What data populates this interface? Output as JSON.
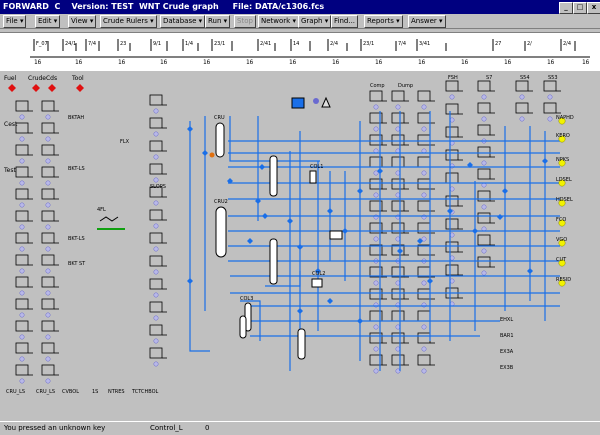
{
  "window": {
    "title": "FORWARD  C    Version: TEST  WNT Crude graph     File: DATA/c1306.fcs",
    "minimize": "_",
    "maximize": "□",
    "close": "x"
  },
  "menubar": {
    "items": [
      {
        "label": "File ▾",
        "dim": false
      },
      {
        "label": "Edit ▾",
        "dim": false
      },
      {
        "label": "View ▾",
        "dim": false
      },
      {
        "label": "Crude Rulers ▾",
        "dim": false
      },
      {
        "label": "Database ▾",
        "dim": false
      },
      {
        "label": "Run ▾",
        "dim": false
      },
      {
        "label": "Stop",
        "dim": true
      },
      {
        "label": "Network ▾",
        "dim": false
      },
      {
        "label": "Graph ▾",
        "dim": false
      },
      {
        "label": "Find...",
        "dim": false
      },
      {
        "label": "Reports ▾",
        "dim": false
      },
      {
        "label": "Answer ▾",
        "dim": false
      }
    ]
  },
  "timeline": {
    "start": "16",
    "labels": [
      "16",
      "16",
      "16",
      "16",
      "16",
      "16",
      "16",
      "16",
      "16",
      "16",
      "16",
      "16",
      "16"
    ]
  },
  "flowsheet": {
    "feed_labels": [
      "Fuel",
      "CrudeCds",
      "Tool"
    ],
    "left_labels": [
      "Cest",
      "Test"
    ],
    "misc_labels": [
      "BKTAH",
      "BKT-LS",
      "BKT-LS",
      "BKT ST",
      "4FL",
      "FLX",
      "SLOPS",
      "COL1",
      "COL2",
      "COL3",
      "CRU",
      "CRU2"
    ],
    "bottom_labels": [
      "CRU_LS",
      "CRU_LS",
      "CVBOL",
      "1S",
      "NTRES",
      "TCTCHBOL"
    ],
    "right_products": [
      "NAPHD",
      "KERO",
      "NPKS",
      "LDSEL",
      "HDSEL",
      "FCO",
      "VGO",
      "CUT",
      "RESID"
    ],
    "right_lower": [
      "EHXL",
      "BAR1",
      "EX3A",
      "EX3B"
    ],
    "tags_top_right": [
      "FSH",
      "S7",
      "S54",
      "S53"
    ],
    "column_headers": [
      "Comp",
      "Dump"
    ]
  },
  "statusbar": {
    "message": "You pressed an unknown key",
    "control": "Control_L",
    "value": "0"
  },
  "colors": {
    "pipe": "#1a6fe8",
    "node": "#1a6fe8",
    "title_bg": "#000080",
    "product": "#f2f200",
    "feed": "#e01010"
  }
}
